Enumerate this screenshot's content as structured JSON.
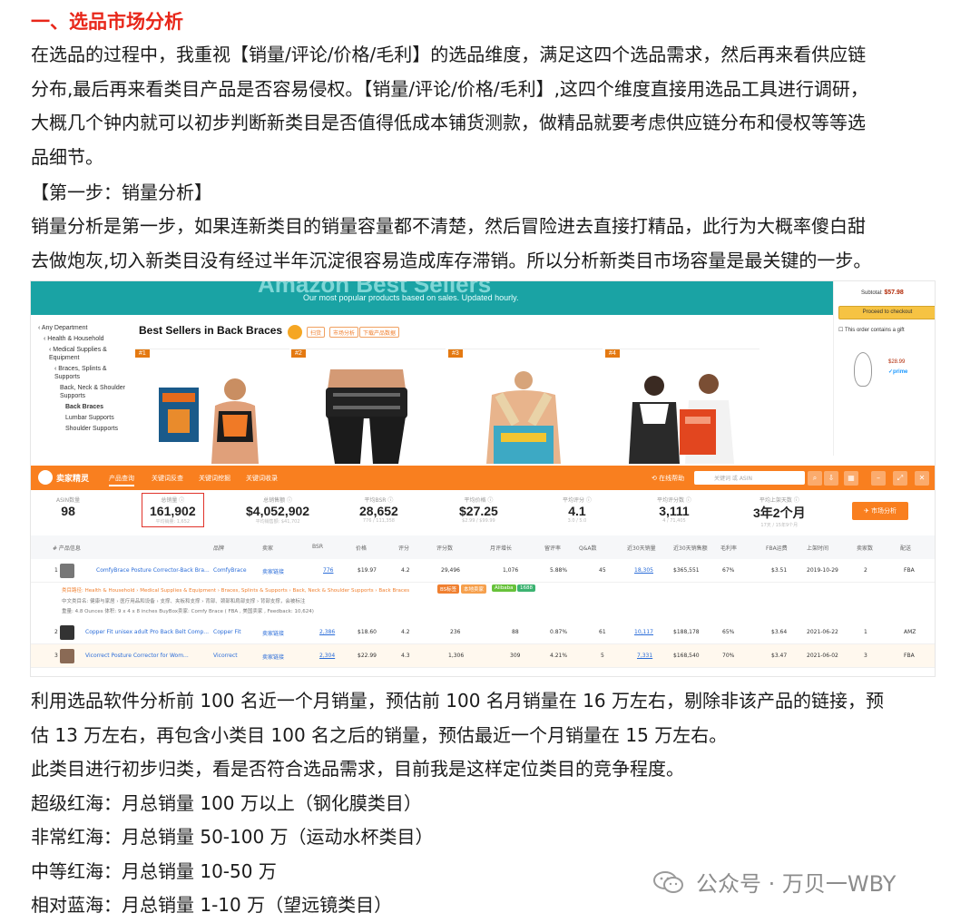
{
  "heading": "一、选品市场分析",
  "intro_paragraph": [
    "在选品的过程中，我重视【销量/评论/价格/毛利】的选品维度，满足这四个选品需求，然后再来看供应链",
    "分布,最后再来看类目产品是否容易侵权。【销量/评论/价格/毛利】,这四个维度直接用选品工具进行调研，",
    "大概几个钟内就可以初步判断新类目是否值得低成本铺货测款，做精品就要考虑供应链分布和侵权等等选",
    "品细节。"
  ],
  "step_heading": "【第一步：销量分析】",
  "step_paragraph": [
    "销量分析是第一步，如果连新类目的销量容量都不清楚，然后冒险进去直接打精品，此行为大概率傻白甜",
    "去做炮灰,切入新类目没有经过半年沉淀很容易造成库存滞销。所以分析新类目市场容量是最关键的一步。"
  ],
  "screenshot": {
    "banner_small": "Our most popular products based on sales. Updated hourly.",
    "banner_big": "Amazon Best Sellers",
    "sidebar": [
      "‹ Any Department",
      "‹ Health & Household",
      "‹ Medical Supplies & Equipment",
      "‹ Braces, Splints & Supports",
      "Back, Neck & Shoulder Supports",
      "Back Braces",
      "Lumbar Supports",
      "Shoulder Supports"
    ],
    "title": "Best Sellers in Back Braces",
    "chips": [
      "扫货",
      "市场分析",
      "下载产品数据"
    ],
    "ranks": [
      "#1",
      "#2",
      "#3",
      "#4"
    ],
    "cart": {
      "subtotal_label": "Subtotal:",
      "subtotal": "$57.98",
      "checkout": "Proceed to checkout",
      "gift": "This order contains a gift",
      "price": "$28.99",
      "prime": "✓prime"
    },
    "toolbar": {
      "brand": "卖家精灵",
      "tabs": [
        "产品查询",
        "关键词反查",
        "关键词挖掘",
        "关键词收录"
      ],
      "site": "⟲ 在线帮助",
      "search_placeholder": "关键词 或 ASIN"
    },
    "stats": [
      {
        "label": "ASIN数量",
        "value": "98",
        "sub": ""
      },
      {
        "label": "总销量 ⓘ",
        "value": "161,902",
        "sub": "平均销量: 1,652"
      },
      {
        "label": "总销售额 ⓘ",
        "value": "$4,052,902",
        "sub": "平均销售额: $41,702"
      },
      {
        "label": "平均BSR ⓘ",
        "value": "28,652",
        "sub": "776 / 111,358"
      },
      {
        "label": "平均价格 ⓘ",
        "value": "$27.25",
        "sub": "$2.99 / $99.99"
      },
      {
        "label": "平均评分 ⓘ",
        "value": "4.1",
        "sub": "3.0 / 5.0"
      },
      {
        "label": "平均评分数 ⓘ",
        "value": "3,111",
        "sub": "4 / 71,405"
      },
      {
        "label": "平均上架天数 ⓘ",
        "value": "3年2个月",
        "sub": "17天 / 15年9个月"
      }
    ],
    "predict_button": "✈ 市场分析",
    "columns": [
      "# 产品信息",
      "品牌",
      "卖家",
      "BSR",
      "价格",
      "评分",
      "评分数",
      "月评增长",
      "留评率",
      "Q&A数",
      "近30天销量",
      "近30天销售额",
      "毛利率",
      "FBA运费",
      "上架时间",
      "卖家数",
      "配送"
    ],
    "rows": [
      {
        "rank": "1",
        "name": "ComfyBrace Posture Corrector-Back Bra...",
        "brand": "ComfyBrace",
        "seller": "卖家链接",
        "bsr": "776",
        "price": "$19.97",
        "rating": "4.2",
        "reviews": "29,496",
        "growth": "1,076",
        "rate": "5.88%",
        "qa": "45",
        "sales": "18,305",
        "revenue": "$365,551",
        "margin": "67%",
        "fba": "$3.51",
        "date": "2019-10-29",
        "sellers": "2",
        "ship": "FBA"
      },
      {
        "rank": "2",
        "name": "Copper Fit unisex adult Pro Back Belt Comp...",
        "brand": "Copper Fit",
        "seller": "卖家链接",
        "bsr": "2,386",
        "price": "$18.60",
        "rating": "4.2",
        "reviews": "236",
        "growth": "88",
        "rate": "0.87%",
        "qa": "61",
        "sales": "10,117",
        "revenue": "$188,178",
        "margin": "65%",
        "fba": "$3.64",
        "date": "2021-06-22",
        "sellers": "1",
        "ship": "AMZ"
      },
      {
        "rank": "3",
        "name": "Vicorrect Posture Corrector for Wom...",
        "brand": "Vicorrect",
        "seller": "卖家链接",
        "bsr": "2,304",
        "price": "$22.99",
        "rating": "4.3",
        "reviews": "1,306",
        "growth": "309",
        "rate": "4.21%",
        "qa": "5",
        "sales": "7,331",
        "revenue": "$168,540",
        "margin": "70%",
        "fba": "$3.47",
        "date": "2021-06-02",
        "sellers": "3",
        "ship": "FBA"
      }
    ],
    "detail": {
      "category": "类目路径: Health & Household › Medical Supplies & Equipment › Braces, Splints & Supports › Back, Neck & Shoulder Supports › Back Braces",
      "badges": [
        "BS标签",
        "本地卖家",
        "Alibaba",
        "1688"
      ],
      "line2": "中文类目名: 健康与家居 › 医疗用品和设备 › 支撑、夹板和支撑 › 背部、颈部和肩部支撑 › 背部支撑，会被标注",
      "line3": "重量: 4.8 Ounces   体积: 9 x 4 x 8 inches   BuyBox卖家: Comfy Brace ( FBA , 美国卖家 , Feedback: 10,624)"
    }
  },
  "analysis_paragraph": [
    "利用选品软件分析前 100 名近一个月销量，预估前 100 名月销量在 16 万左右，剔除非该产品的链接，预",
    "估 13 万左右，再包含小类目 100 名之后的销量，预估最近一个月销量在 15 万左右。"
  ],
  "classify_intro": "此类目进行初步归类，看是否符合选品需求，目前我是这样定位类目的竞争程度。",
  "levels": [
    "超级红海：月总销量 100 万以上（钢化膜类目）",
    "非常红海：月总销量 50-100 万（运动水杯类目）",
    "中等红海：月总销量 10-50 万",
    "相对蓝海：月总销量 1-10 万（望远镜类目）"
  ],
  "watermark": "公众号 · 万贝一WBY",
  "colors": {
    "heading": "#e8271a",
    "toolbar": "#f97f1f",
    "banner": "#1aa3a4",
    "highlight_box": "#e0332a"
  }
}
